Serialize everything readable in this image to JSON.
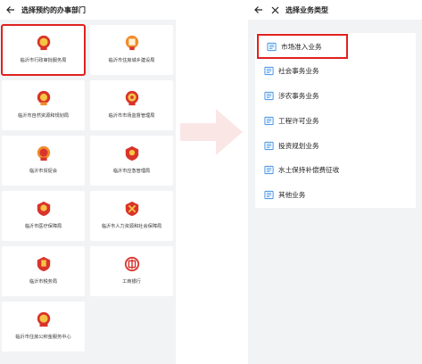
{
  "left": {
    "title": "选择预约的办事部门",
    "departments": [
      {
        "label": "临沂市行政审批服务局"
      },
      {
        "label": "临沂市住房城乡建设局"
      },
      {
        "label": "临沂市自然资源和规划局"
      },
      {
        "label": "临沂市市场监督管理局"
      },
      {
        "label": "临沂市贸促会"
      },
      {
        "label": "临沂市应急管理局"
      },
      {
        "label": "临沂市医疗保障局"
      },
      {
        "label": "临沂市人力资源和社会保障局"
      },
      {
        "label": "临沂市税务局"
      },
      {
        "label": "工商银行"
      },
      {
        "label": "临沂市住房公积金服务中心"
      }
    ]
  },
  "right": {
    "title": "选择业务类型",
    "items": [
      {
        "label": "市场准入业务"
      },
      {
        "label": "社会事务业务"
      },
      {
        "label": "涉农事务业务"
      },
      {
        "label": "工程许可业务"
      },
      {
        "label": "投资规划业务"
      },
      {
        "label": "水土保持补偿费征收"
      },
      {
        "label": "其他业务"
      }
    ]
  },
  "colors": {
    "highlight": "#e02020",
    "emblem_orange": "#f08c2e",
    "emblem_red": "#d9342b",
    "doc_icon": "#3a8ee6",
    "background": "#f2f3f5"
  },
  "icons": {
    "back": "arrow-left-icon",
    "close": "close-icon",
    "department": "emblem-icon",
    "business": "document-icon"
  }
}
